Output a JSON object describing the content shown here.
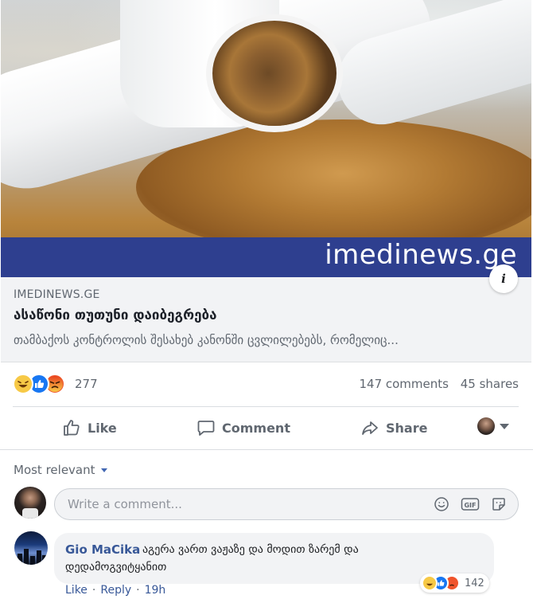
{
  "hero": {
    "watermark": "imedinews.ge",
    "info_glyph": "i"
  },
  "link_preview": {
    "domain": "IMEDINEWS.GE",
    "title": "ასაწონი თუთუნი დაიბეგრება",
    "description": "თამბაქოს კონტროლის შესახებ კანონში ცვლილებებს, რომელიც..."
  },
  "stats": {
    "reaction_icons": [
      "haha-reaction-icon",
      "like-reaction-icon",
      "angry-reaction-icon"
    ],
    "reaction_count": "277",
    "comments": "147 comments",
    "shares": "45 shares"
  },
  "actions": {
    "like": "Like",
    "comment": "Comment",
    "share": "Share"
  },
  "comments_section": {
    "sort_label": "Most relevant",
    "input_placeholder": "Write a comment...",
    "comments": [
      {
        "author": "Gio MaCika",
        "text_line1": "აგერა ვართ ვაჟაზე და მოდით ზარემ და",
        "text_line2": "დედამოგვიტყანით",
        "reaction_count": "142",
        "like_label": "Like",
        "reply_label": "Reply",
        "separator": "·",
        "time": "19h"
      }
    ]
  },
  "colors": {
    "brand_bar": "#2e3f8f",
    "link_blue": "#385898",
    "like_blue": "#1877f2",
    "haha_yellow": "#f7c946",
    "angry_orange": "#f0542c"
  }
}
